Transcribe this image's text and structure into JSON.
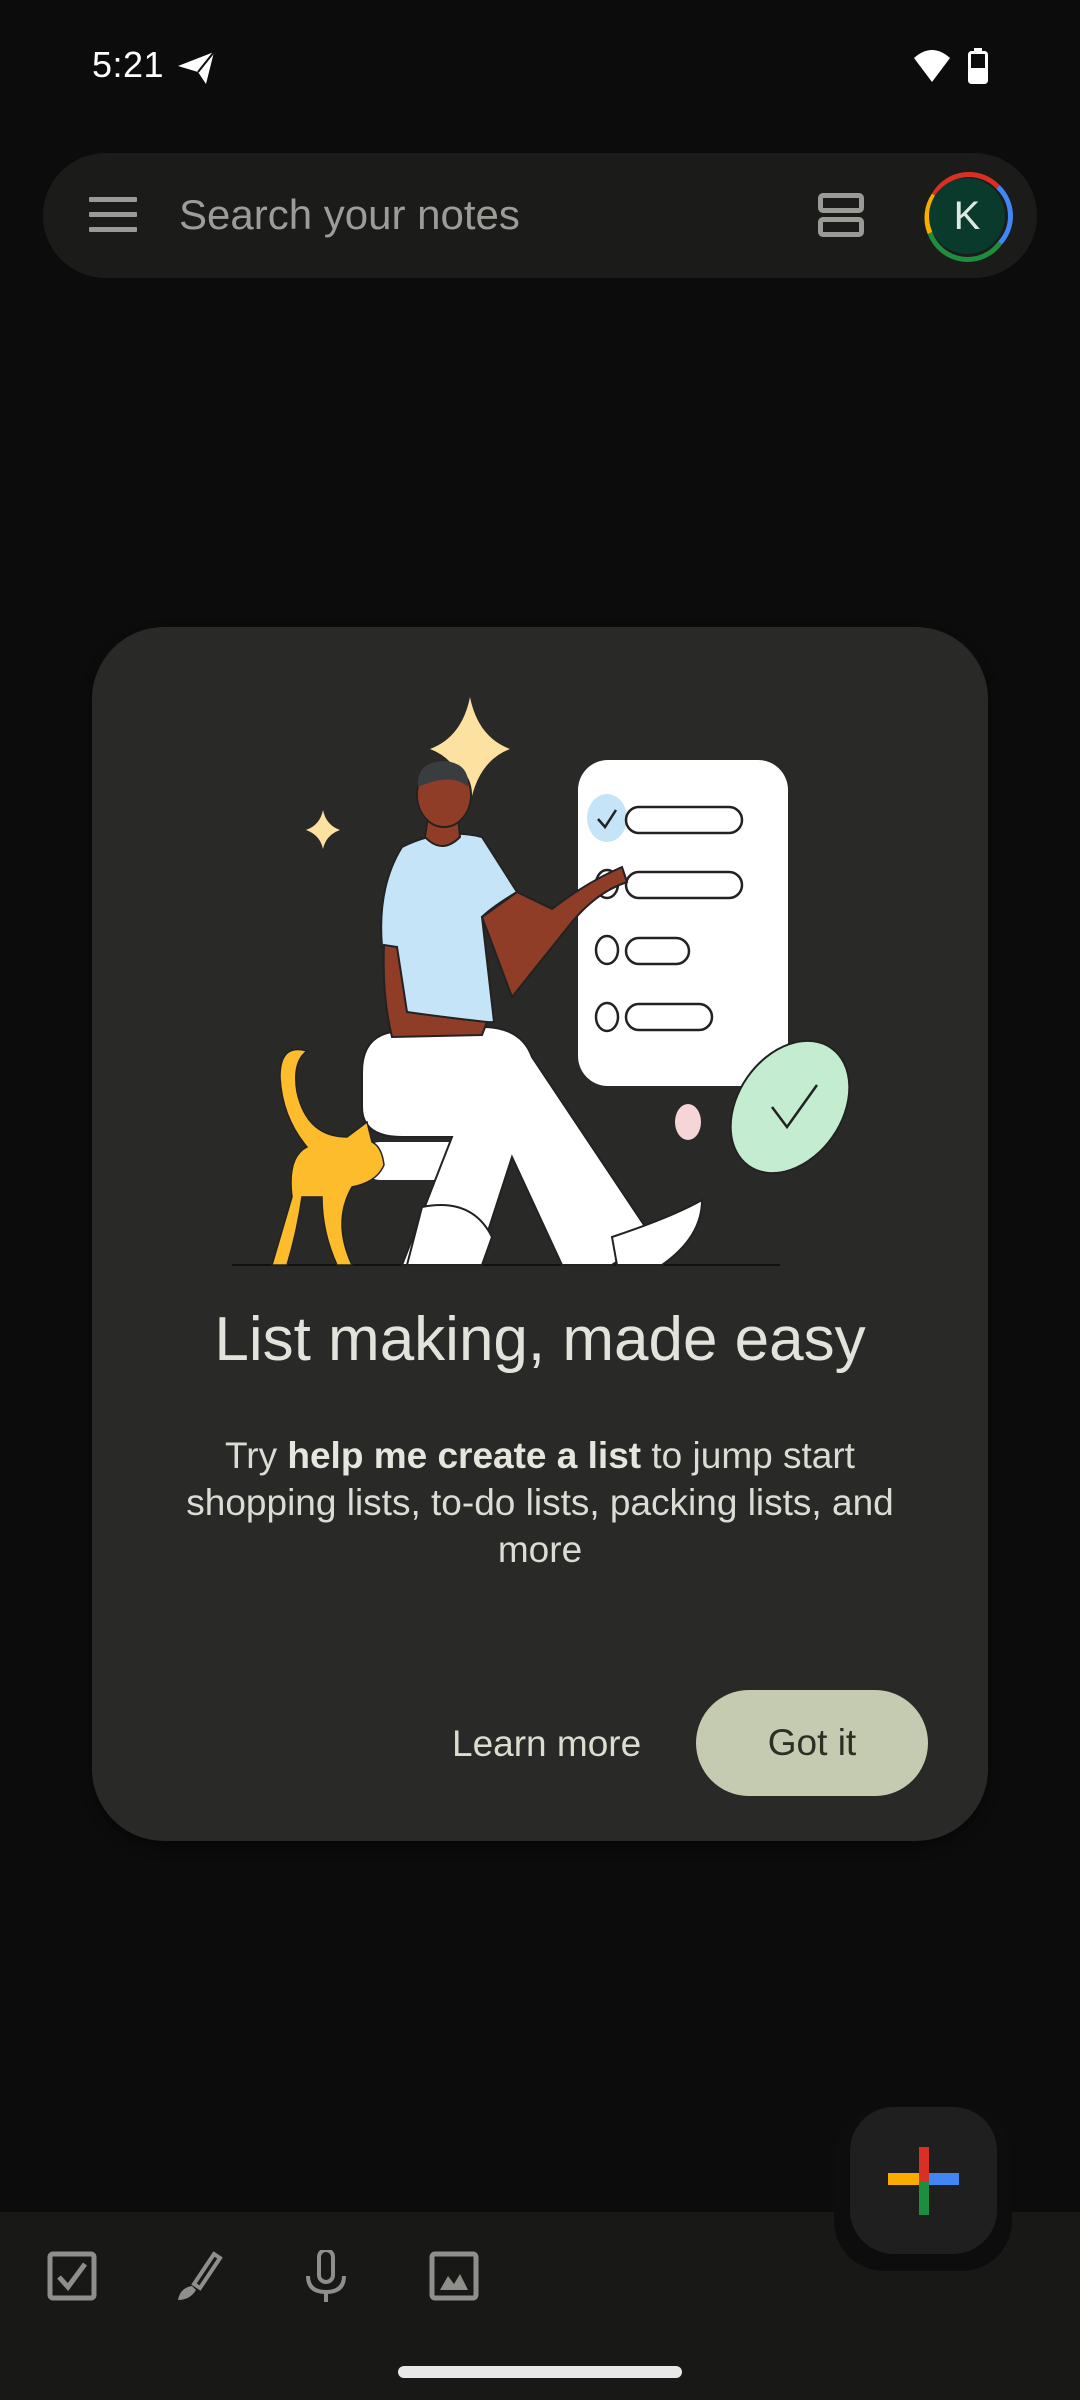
{
  "status_bar": {
    "time": "5:21",
    "icons": [
      "telegram-icon",
      "wifi-icon",
      "battery-icon"
    ],
    "battery_level": 0.4
  },
  "search_bar": {
    "menu_icon": "menu-icon",
    "placeholder": "Search your notes",
    "layout_icon": "list-view-icon",
    "avatar_initial": "K",
    "avatar_color": "#0a3a2c",
    "avatar_ring_colors": [
      "#d93025",
      "#4285f4",
      "#1e8e3e",
      "#f9ab00"
    ]
  },
  "card": {
    "illustration": "person-with-checklist-illustration",
    "title": "List making, made easy",
    "body_prefix": "Try ",
    "body_bold": "help me create a list",
    "body_suffix": " to jump start shopping lists, to-do lists, packing lists, and more",
    "learn_more_label": "Learn more",
    "got_it_label": "Got it",
    "got_it_color": "#c5cbb1"
  },
  "fab": {
    "icon": "plus-icon",
    "colors": {
      "top": "#d93025",
      "right": "#4285f4",
      "bottom": "#1e8e3e",
      "left": "#f9ab00"
    }
  },
  "bottom_bar": {
    "items": [
      {
        "name": "new-list",
        "icon": "checkbox-icon"
      },
      {
        "name": "new-drawing",
        "icon": "brush-icon"
      },
      {
        "name": "new-audio",
        "icon": "microphone-icon"
      },
      {
        "name": "new-image",
        "icon": "image-icon"
      }
    ]
  }
}
